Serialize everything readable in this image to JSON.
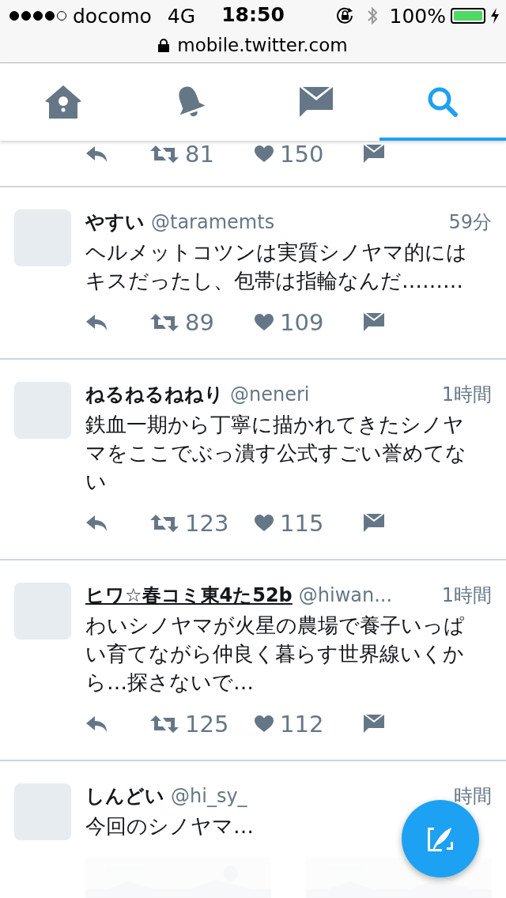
{
  "status_bar": {
    "carrier": "docomo",
    "network": "4G",
    "time": "18:50",
    "battery_text": "100%",
    "battery": {
      "level": 1
    },
    "charging": true
  },
  "address_bar": {
    "url": "mobile.twitter.com",
    "secure": true
  },
  "tabs": [
    {
      "kind": "home",
      "selected": false
    },
    {
      "kind": "notifications",
      "selected": false
    },
    {
      "kind": "messages",
      "selected": false
    },
    {
      "kind": "search",
      "selected": true
    }
  ],
  "partial_tweet": {
    "retweets": "81",
    "likes": "150"
  },
  "tweets": [
    {
      "name": "やすい",
      "handle": "@taramemts",
      "time": "59分",
      "underlined": false,
      "text": "ヘルメットコツンは実質シノヤマ的にはキスだったし、包帯は指輪なんだ………",
      "retweets": "89",
      "likes": "109"
    },
    {
      "name": "ねるねるねねり",
      "handle": "@neneri",
      "time": "1時間",
      "underlined": false,
      "text": "鉄血一期から丁寧に描かれてきたシノヤマをここでぶっ潰す公式すごい誉めてない",
      "retweets": "123",
      "likes": "115"
    },
    {
      "name": "ヒワ☆春コミ東4た52b",
      "handle": "@hiwan...",
      "time": "1時間",
      "underlined": true,
      "text": "わいシノヤマが火星の農場で養子いっぱい育てながら仲良く暮らす世界線いくから…探さないで…",
      "retweets": "125",
      "likes": "112"
    },
    {
      "name": "しんどい",
      "handle": "@hi_sy_",
      "time": "時間",
      "underlined": false,
      "text": "今回のシノヤマ…"
    }
  ]
}
